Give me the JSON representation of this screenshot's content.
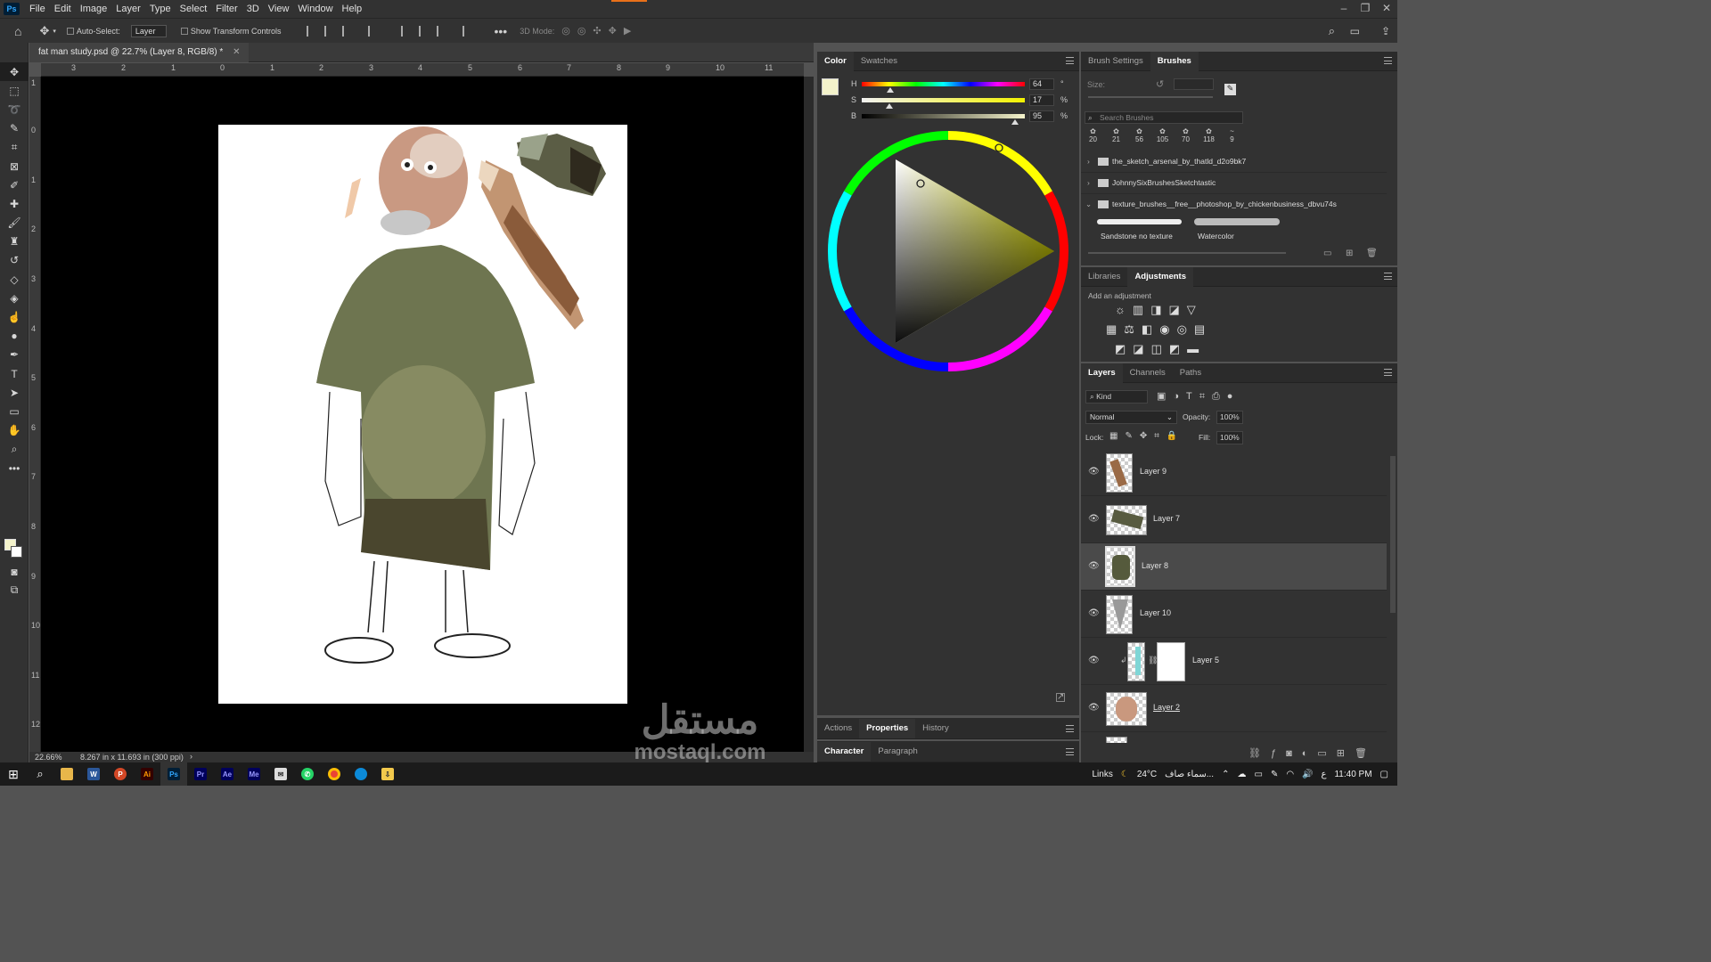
{
  "menubar": {
    "logo": "Ps",
    "items": [
      "File",
      "Edit",
      "Image",
      "Layer",
      "Type",
      "Select",
      "Filter",
      "3D",
      "View",
      "Window",
      "Help"
    ]
  },
  "options": {
    "auto_select_label": "Auto-Select:",
    "auto_select_value": "Layer",
    "show_transform_label": "Show Transform Controls",
    "mode_3d_label": "3D Mode:"
  },
  "document": {
    "tab_title": "fat man study.psd @ 22.7% (Layer 8, RGB/8) *",
    "zoom": "22.66%",
    "doc_info": "8.267 in x 11.693 in (300 ppi)",
    "ruler_top": [
      "3",
      "2",
      "1",
      "0",
      "1",
      "2",
      "3",
      "4",
      "5",
      "6",
      "7",
      "8",
      "9",
      "10",
      "11"
    ],
    "ruler_left": [
      "1",
      "0",
      "1",
      "2",
      "3",
      "4",
      "5",
      "6",
      "7",
      "8",
      "9",
      "10",
      "11",
      "12"
    ]
  },
  "color_panel": {
    "tabs": [
      "Color",
      "Swatches"
    ],
    "h_label": "H",
    "h_value": "64",
    "h_unit": "°",
    "s_label": "S",
    "s_value": "17",
    "s_unit": "%",
    "b_label": "B",
    "b_value": "95",
    "b_unit": "%",
    "fg_color": "#f4f3cb"
  },
  "brush_panel": {
    "tabs": [
      "Brush Settings",
      "Brushes"
    ],
    "size_label": "Size:",
    "search_placeholder": "Search Brushes",
    "presets": [
      "20",
      "21",
      "56",
      "105",
      "70",
      "118",
      "9"
    ],
    "groups": [
      "the_sketch_arsenal_by_thatld_d2o9bk7",
      "JohnnySixBrushesSketchtastic",
      "texture_brushes__free__photoshop_by_chickenbusiness_dbvu74s"
    ],
    "brush_names": [
      "Sandstone no texture",
      "Watercolor"
    ]
  },
  "adj_panel": {
    "tabs": [
      "Libraries",
      "Adjustments"
    ],
    "hint": "Add an adjustment"
  },
  "layers_panel": {
    "tabs": [
      "Layers",
      "Channels",
      "Paths"
    ],
    "kind_label": "Kind",
    "blend_mode": "Normal",
    "opacity_label": "Opacity:",
    "opacity_value": "100%",
    "lock_label": "Lock:",
    "fill_label": "Fill:",
    "fill_value": "100%",
    "layers": [
      "Layer 9",
      "Layer 7",
      "Layer 8",
      "Layer 10",
      "Layer 5",
      "Layer 2"
    ]
  },
  "bottom_panels": {
    "tabs1": [
      "Actions",
      "Properties",
      "History"
    ],
    "tabs2": [
      "Character",
      "Paragraph"
    ]
  },
  "taskbar": {
    "links": "Links",
    "weather": "24°C",
    "weather_desc": "سماء صاف...",
    "lang": "ع",
    "time": "11:40 PM"
  },
  "watermark": {
    "arabic": "مستقل",
    "latin": "mostaql.com"
  }
}
